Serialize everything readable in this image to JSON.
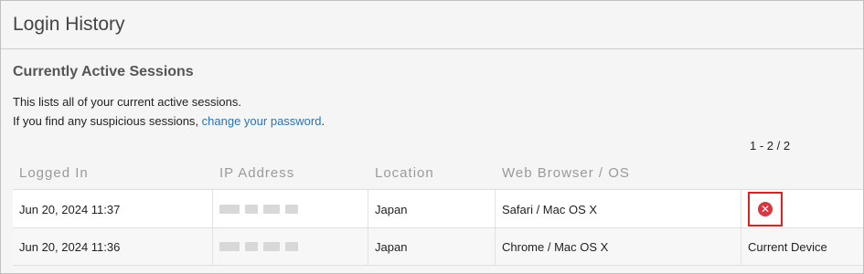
{
  "page": {
    "title": "Login History"
  },
  "section": {
    "title": "Currently Active Sessions",
    "description_line1": "This lists all of your current active sessions.",
    "description_line2_prefix": "If you find any suspicious sessions, ",
    "change_password_link": "change your password",
    "description_line2_suffix": "."
  },
  "pager": {
    "range": "1 - 2 / 2"
  },
  "table": {
    "headers": [
      "Logged In",
      "IP Address",
      "Location",
      "Web Browser / OS"
    ],
    "rows": [
      {
        "logged_in": "Jun 20, 2024 11:37",
        "location": "Japan",
        "browser_os": "Safari / Mac OS X",
        "action": "delete-session"
      },
      {
        "logged_in": "Jun 20, 2024 11:36",
        "location": "Japan",
        "browser_os": "Chrome / Mac OS X",
        "status": "Current Device"
      }
    ]
  },
  "icons": {
    "delete": "close-circle-icon"
  },
  "colors": {
    "link": "#2a73b7",
    "delete_icon": "#d9363e",
    "highlight_border": "#e02020"
  }
}
